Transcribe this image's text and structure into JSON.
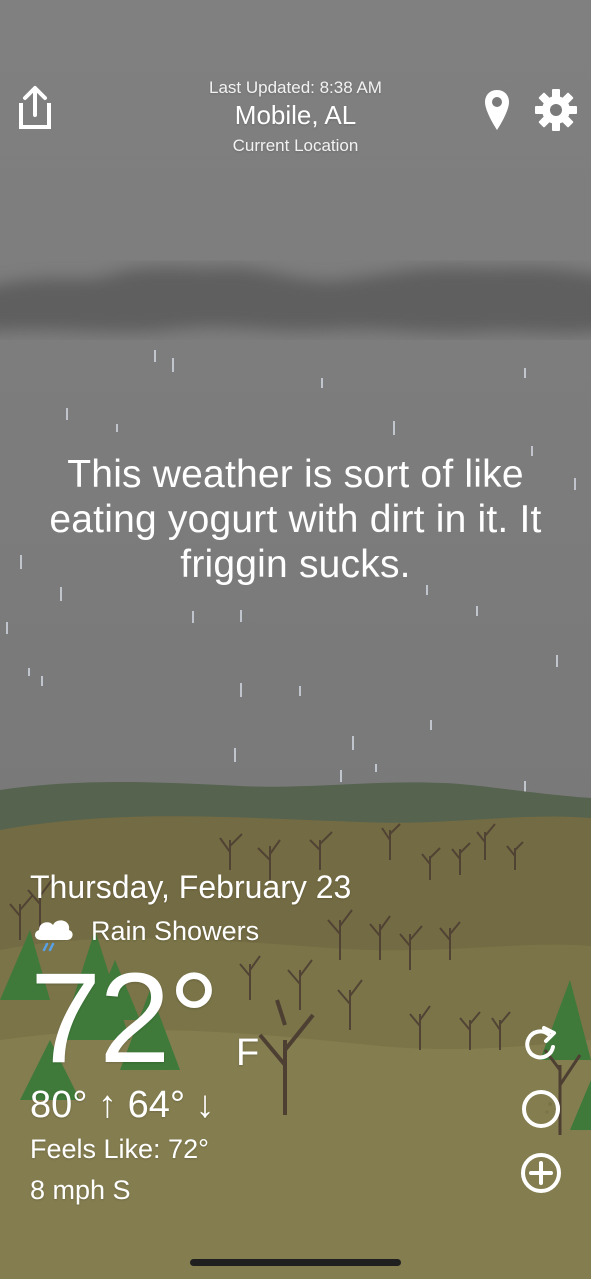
{
  "header": {
    "last_updated": "Last Updated: 8:38 AM",
    "city": "Mobile, AL",
    "location_label": "Current Location"
  },
  "quote": "This weather is sort of like eating yogurt with dirt in it. It friggin sucks.",
  "forecast": {
    "date": "Thursday, February 23",
    "condition": "Rain Showers",
    "condition_icon": "rain-cloud-icon",
    "temperature": "72°",
    "unit": "F",
    "high_low": "80° ↑  64° ↓",
    "feels_like": "Feels Like: 72°",
    "wind": "8 mph S"
  },
  "icons": {
    "share": "share-icon",
    "location": "location-pin-icon",
    "settings": "gear-icon",
    "refresh": "refresh-icon",
    "moon": "moon-icon",
    "add": "add-icon"
  },
  "colors": {
    "sky": "#7a7a7a",
    "cloud": "#5f5f5f",
    "far_hills": "#55634f",
    "ground": "#7b7448",
    "trees": "#4e3f33",
    "pines": "#3f7a3a"
  }
}
